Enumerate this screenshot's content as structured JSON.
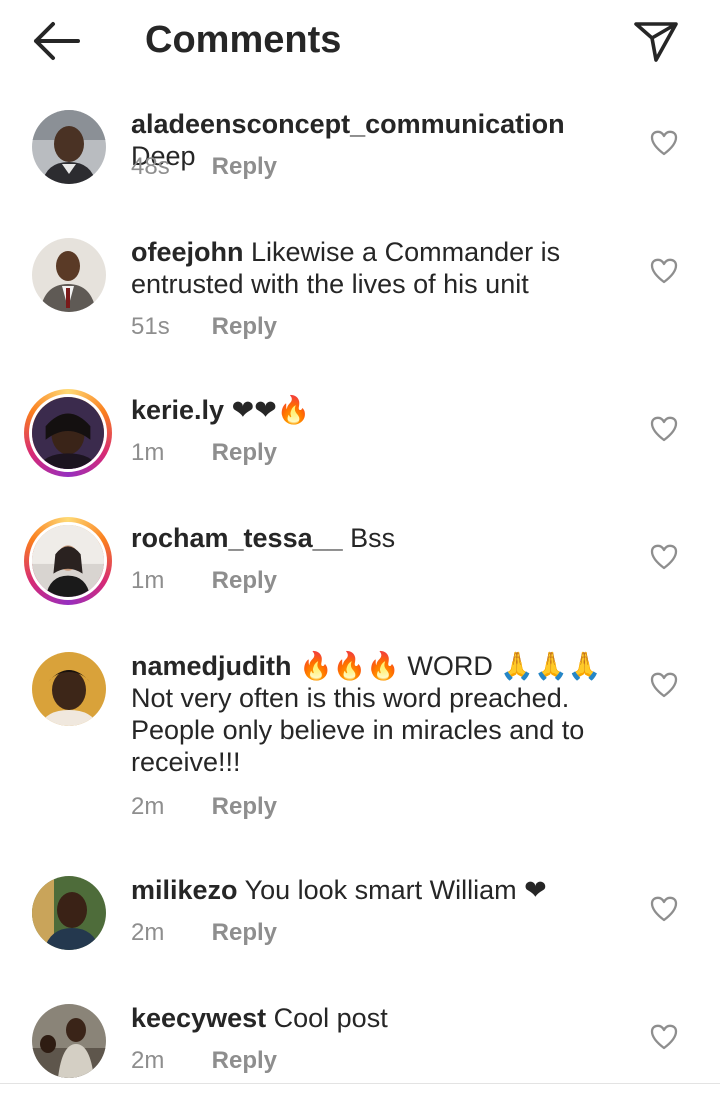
{
  "header": {
    "title": "Comments",
    "back_icon": "arrow-left-icon",
    "send_icon": "paper-plane-icon"
  },
  "comments": [
    {
      "username": "aladeensconcept_communication",
      "text": "Deep",
      "time": "48s",
      "reply": "Reply",
      "story_ring": false
    },
    {
      "username": "ofeejohn",
      "text": "Likewise a Commander is entrusted with the lives of his unit",
      "time": "51s",
      "reply": "Reply",
      "story_ring": false
    },
    {
      "username": "kerie.ly",
      "text": "❤❤🔥",
      "time": "1m",
      "reply": "Reply",
      "story_ring": true
    },
    {
      "username": "rocham_tessa__",
      "text": "Bss",
      "time": "1m",
      "reply": "Reply",
      "story_ring": true
    },
    {
      "username": "namedjudith",
      "text": "🔥🔥🔥 WORD 🙏🙏🙏 Not very often is this word preached. People only believe in miracles and to receive!!!",
      "time": "2m",
      "reply": "Reply",
      "story_ring": false
    },
    {
      "username": "milikezo",
      "text": "You look smart William ❤",
      "time": "2m",
      "reply": "Reply",
      "story_ring": false
    },
    {
      "username": "keecywest",
      "text": "Cool  post",
      "time": "2m",
      "reply": "Reply",
      "story_ring": false
    }
  ],
  "colors": {
    "text": "#262626",
    "meta": "#8e8e8e",
    "heart": "#e0102a",
    "fire": "#f07a10",
    "divider": "#e3e3e3"
  }
}
